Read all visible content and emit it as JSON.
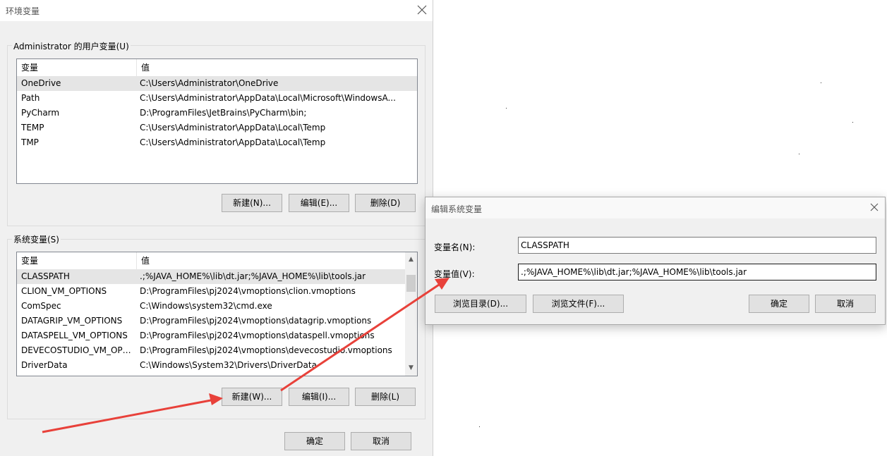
{
  "main_window": {
    "title": "环境变量",
    "user_group_label": "Administrator 的用户变量(U)",
    "system_group_label": "系统变量(S)",
    "columns": [
      "变量",
      "值"
    ],
    "user_vars": [
      {
        "name": "OneDrive",
        "value": "C:\\Users\\Administrator\\OneDrive"
      },
      {
        "name": "Path",
        "value": "C:\\Users\\Administrator\\AppData\\Local\\Microsoft\\WindowsA..."
      },
      {
        "name": "PyCharm",
        "value": "D:\\ProgramFiles\\JetBrains\\PyCharm\\bin;"
      },
      {
        "name": "TEMP",
        "value": "C:\\Users\\Administrator\\AppData\\Local\\Temp"
      },
      {
        "name": "TMP",
        "value": "C:\\Users\\Administrator\\AppData\\Local\\Temp"
      }
    ],
    "system_vars": [
      {
        "name": "CLASSPATH",
        "value": ".;%JAVA_HOME%\\lib\\dt.jar;%JAVA_HOME%\\lib\\tools.jar"
      },
      {
        "name": "CLION_VM_OPTIONS",
        "value": "D:\\ProgramFiles\\pj2024\\vmoptions\\clion.vmoptions"
      },
      {
        "name": "ComSpec",
        "value": "C:\\Windows\\system32\\cmd.exe"
      },
      {
        "name": "DATAGRIP_VM_OPTIONS",
        "value": "D:\\ProgramFiles\\pj2024\\vmoptions\\datagrip.vmoptions"
      },
      {
        "name": "DATASPELL_VM_OPTIONS",
        "value": "D:\\ProgramFiles\\pj2024\\vmoptions\\dataspell.vmoptions"
      },
      {
        "name": "DEVECOSTUDIO_VM_OPT...",
        "value": "D:\\ProgramFiles\\pj2024\\vmoptions\\devecostudio.vmoptions"
      },
      {
        "name": "DriverData",
        "value": "C:\\Windows\\System32\\Drivers\\DriverData"
      }
    ],
    "user_buttons": {
      "new": "新建(N)...",
      "edit": "编辑(E)...",
      "delete": "删除(D)"
    },
    "system_buttons": {
      "new": "新建(W)...",
      "edit": "编辑(I)...",
      "delete": "删除(L)"
    },
    "ok": "确定",
    "cancel": "取消"
  },
  "edit_dialog": {
    "title": "编辑系统变量",
    "name_label": "变量名(N):",
    "name_value": "CLASSPATH",
    "value_label": "变量值(V):",
    "value_value": ".;%JAVA_HOME%\\lib\\dt.jar;%JAVA_HOME%\\lib\\tools.jar",
    "browse_dir": "浏览目录(D)...",
    "browse_file": "浏览文件(F)...",
    "ok": "确定",
    "cancel": "取消"
  },
  "colors": {
    "annotation_arrow": "#e8413a",
    "selected_row": "#e5e5e5",
    "window_bg": "#f0f0f0"
  }
}
